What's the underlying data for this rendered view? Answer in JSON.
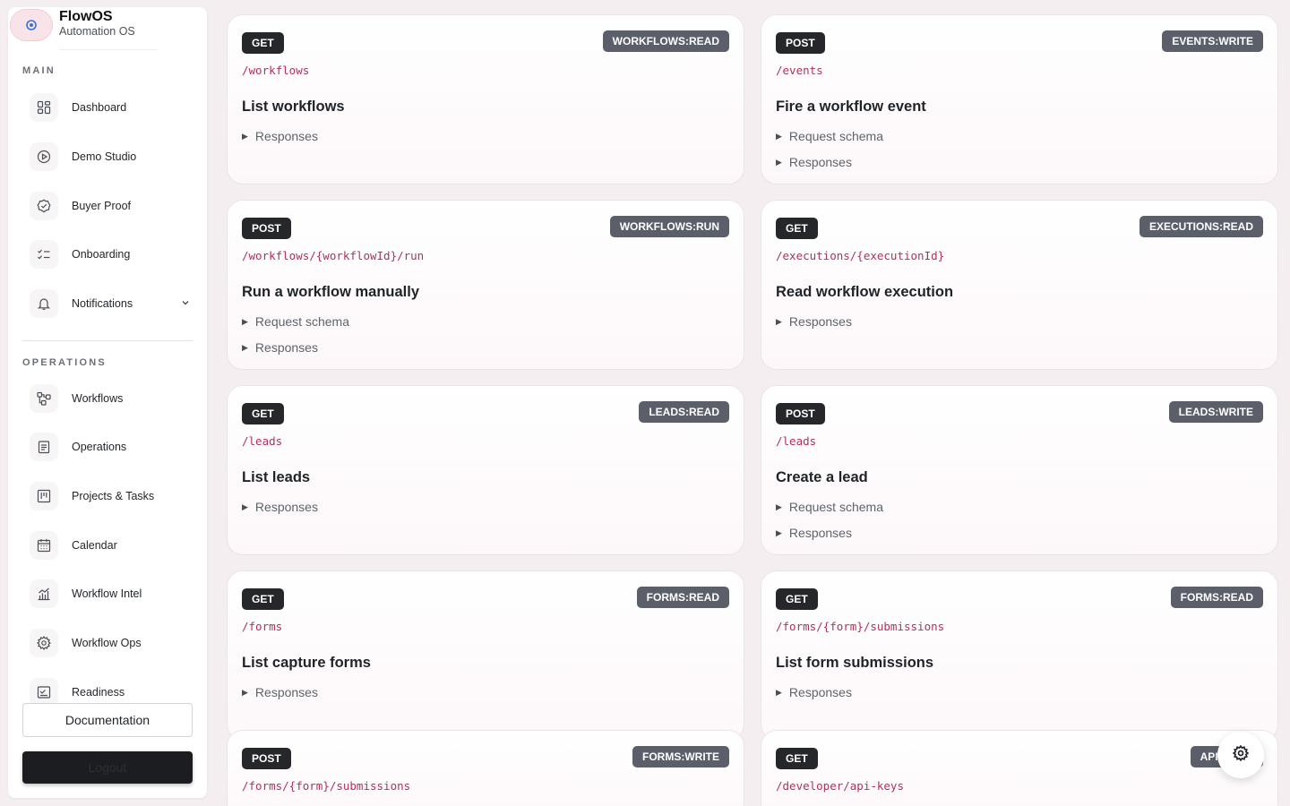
{
  "brand": {
    "name": "FlowOS",
    "subtitle": "Automation OS"
  },
  "sidebar": {
    "main_label": "MAIN",
    "main_items": [
      {
        "label": "Dashboard",
        "icon": "dashboard-grid-icon"
      },
      {
        "label": "Demo Studio",
        "icon": "play-circle-icon"
      },
      {
        "label": "Buyer Proof",
        "icon": "check-badge-icon"
      },
      {
        "label": "Onboarding",
        "icon": "checklist-icon"
      },
      {
        "label": "Notifications",
        "icon": "bell-icon",
        "expandable": true
      }
    ],
    "operations_label": "OPERATIONS",
    "operations_items": [
      {
        "label": "Workflows",
        "icon": "workflow-nodes-icon"
      },
      {
        "label": "Operations",
        "icon": "clipboard-icon"
      },
      {
        "label": "Projects & Tasks",
        "icon": "kanban-icon"
      },
      {
        "label": "Calendar",
        "icon": "calendar-icon"
      },
      {
        "label": "Workflow Intel",
        "icon": "chart-icon"
      },
      {
        "label": "Workflow Ops",
        "icon": "gear-icon"
      },
      {
        "label": "Readiness",
        "icon": "readiness-icon"
      }
    ],
    "documentation_label": "Documentation",
    "logout_label": "Logout"
  },
  "endpoints": [
    {
      "method": "GET",
      "scope": "WORKFLOWS:READ",
      "path": "/workflows",
      "title": "List workflows",
      "sections": [
        "Responses"
      ]
    },
    {
      "method": "POST",
      "scope": "EVENTS:WRITE",
      "path": "/events",
      "title": "Fire a workflow event",
      "sections": [
        "Request schema",
        "Responses"
      ]
    },
    {
      "method": "POST",
      "scope": "WORKFLOWS:RUN",
      "path": "/workflows/{workflowId}/run",
      "title": "Run a workflow manually",
      "sections": [
        "Request schema",
        "Responses"
      ]
    },
    {
      "method": "GET",
      "scope": "EXECUTIONS:READ",
      "path": "/executions/{executionId}",
      "title": "Read workflow execution",
      "sections": [
        "Responses"
      ]
    },
    {
      "method": "GET",
      "scope": "LEADS:READ",
      "path": "/leads",
      "title": "List leads",
      "sections": [
        "Responses"
      ]
    },
    {
      "method": "POST",
      "scope": "LEADS:WRITE",
      "path": "/leads",
      "title": "Create a lead",
      "sections": [
        "Request schema",
        "Responses"
      ]
    },
    {
      "method": "GET",
      "scope": "FORMS:READ",
      "path": "/forms",
      "title": "List capture forms",
      "sections": [
        "Responses"
      ]
    },
    {
      "method": "GET",
      "scope": "FORMS:READ",
      "path": "/forms/{form}/submissions",
      "title": "List form submissions",
      "sections": [
        "Responses"
      ]
    },
    {
      "method": "POST",
      "scope": "FORMS:WRITE",
      "path": "/forms/{form}/submissions",
      "title": "",
      "sections": []
    },
    {
      "method": "GET",
      "scope": "API_KEYS",
      "path": "/developer/api-keys",
      "title": "",
      "sections": []
    }
  ],
  "fab": {
    "icon": "gear-icon"
  }
}
